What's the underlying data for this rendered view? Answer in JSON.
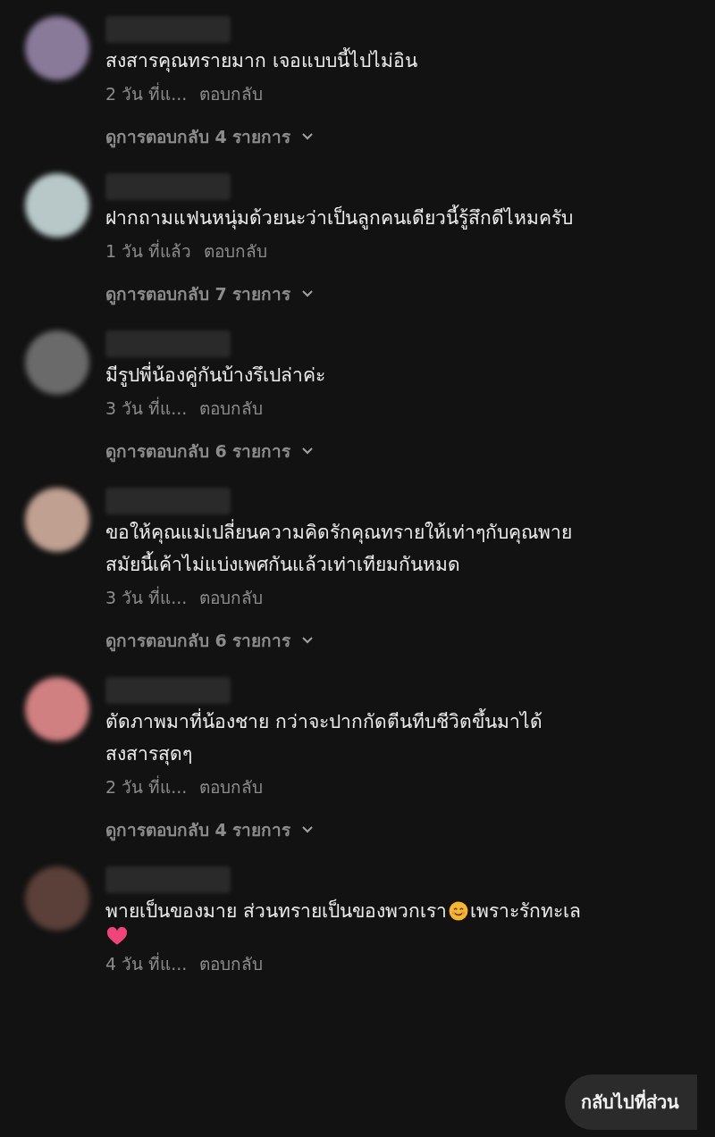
{
  "comments": [
    {
      "lines": [
        [
          {
            "kind": "text",
            "text": "สงสารคุณทรายมาก เจอแบบนี้ไปไม่อิน"
          }
        ]
      ],
      "time": "2 วัน ที่แ...",
      "reply": "ตอบกลับ",
      "view_replies": "ดูการตอบกลับ 4 รายการ"
    },
    {
      "lines": [
        [
          {
            "kind": "text",
            "text": "ฝากถามแฟนหนุ่มด้วยนะว่าเป็นลูกคนเดียวนี้รู้สึกดีไหมครับ"
          }
        ]
      ],
      "time": "1 วัน ที่แล้ว",
      "reply": "ตอบกลับ",
      "view_replies": "ดูการตอบกลับ 7 รายการ"
    },
    {
      "lines": [
        [
          {
            "kind": "text",
            "text": "มีรูปพี่น้องคู่กันบ้างรึเปล่าค่ะ"
          }
        ]
      ],
      "time": "3 วัน ที่แ...",
      "reply": "ตอบกลับ",
      "view_replies": "ดูการตอบกลับ 6 รายการ"
    },
    {
      "lines": [
        [
          {
            "kind": "text",
            "text": "ขอให้คุณแม่เปลี่ยนความคิดรักคุณทรายให้เท่าๆกับคุณพาย"
          }
        ],
        [
          {
            "kind": "text",
            "text": "สมัยนี้เค้าไม่แบ่งเพศกันแล้วเท่าเทียมกันหมด"
          }
        ]
      ],
      "time": "3 วัน ที่แ...",
      "reply": "ตอบกลับ",
      "view_replies": "ดูการตอบกลับ 6 รายการ"
    },
    {
      "lines": [
        [
          {
            "kind": "text",
            "text": "ตัดภาพมาที่น้องชาย กว่าจะปากกัดตีนทีบชีวิตขึ้นมาได้"
          }
        ],
        [
          {
            "kind": "text",
            "text": "สงสารสุดๆ"
          }
        ]
      ],
      "time": "2 วัน ที่แ...",
      "reply": "ตอบกลับ",
      "view_replies": "ดูการตอบกลับ 4 รายการ"
    },
    {
      "lines": [
        [
          {
            "kind": "text",
            "text": "พายเป็นของมาย ส่วนทรายเป็นของพวกเรา"
          },
          {
            "kind": "smile"
          },
          {
            "kind": "text",
            "text": " เพราะรักทะเล"
          }
        ],
        [
          {
            "kind": "heart"
          }
        ]
      ],
      "time": "4 วัน ที่แ...",
      "reply": "ตอบกลับ"
    }
  ],
  "back_button": "กลับไปที่ส่วน"
}
